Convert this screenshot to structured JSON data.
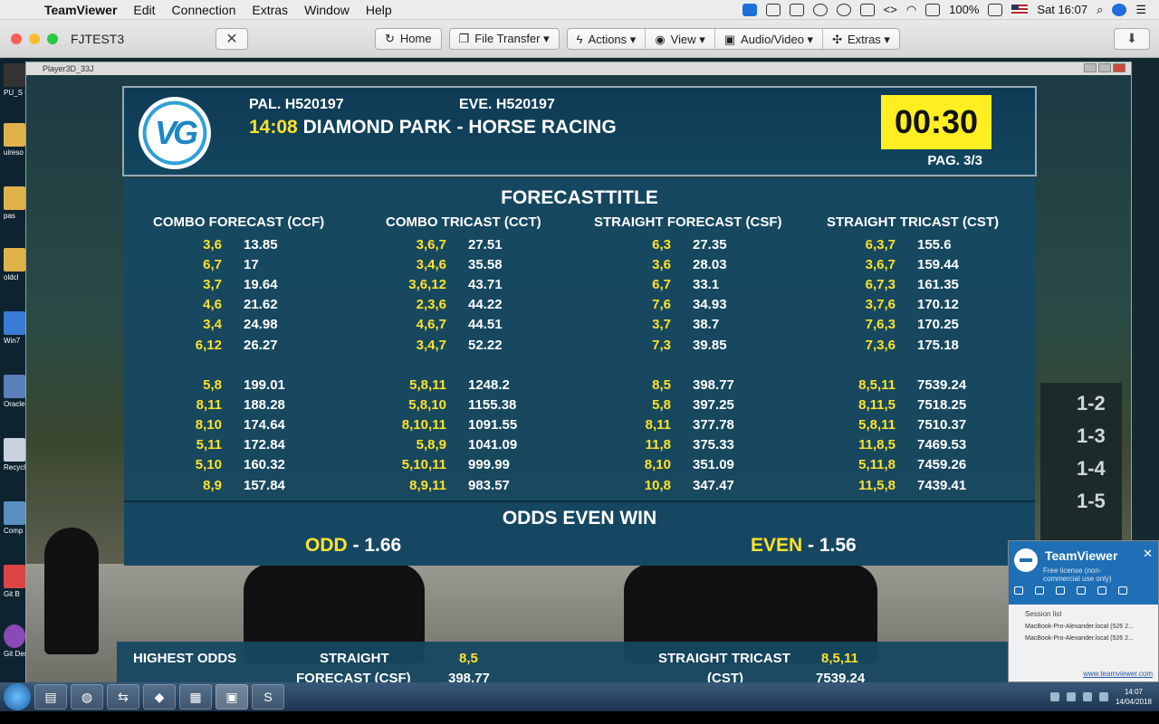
{
  "menubar": {
    "apple": "",
    "app": "TeamViewer",
    "items": [
      "Edit",
      "Connection",
      "Extras",
      "Window",
      "Help"
    ],
    "battery": "100%",
    "clock": "Sat 16:07"
  },
  "toolbar": {
    "session_title": "FJTEST3",
    "close_label": "✕",
    "home": "Home",
    "file_transfer": "File Transfer ▾",
    "actions": "Actions ▾",
    "view": "View ▾",
    "audio_video": "Audio/Video ▾",
    "extras": "Extras ▾",
    "download_icon": "⬇"
  },
  "desktop": {
    "icons": [
      {
        "label": "PU_S Shor"
      },
      {
        "label": "uireso"
      },
      {
        "label": "pas"
      },
      {
        "label": "oldcl"
      },
      {
        "label": "Win7"
      },
      {
        "label": "Oracle Virtu"
      },
      {
        "label": "Recycl"
      },
      {
        "label": "Comp"
      },
      {
        "label": "Git B"
      },
      {
        "label": "Git Desk"
      }
    ]
  },
  "player": {
    "title": "Player3D_33J"
  },
  "broadcast": {
    "logo_text": "VG",
    "pal": "PAL. H520197",
    "eve": "EVE. H520197",
    "race_time": "14:08",
    "race_name": "DIAMOND PARK - HORSE RACING",
    "timer": "00:30",
    "page": "PAG. 3/3",
    "forecast_title": "FORECASTTITLE",
    "columns": [
      {
        "header": "COMBO FORECAST (CCF)",
        "rows": [
          {
            "combo": "3,6",
            "value": "13.85"
          },
          {
            "combo": "6,7",
            "value": "17"
          },
          {
            "combo": "3,7",
            "value": "19.64"
          },
          {
            "combo": "4,6",
            "value": "21.62"
          },
          {
            "combo": "3,4",
            "value": "24.98"
          },
          {
            "combo": "6,12",
            "value": "26.27"
          }
        ],
        "rows2": [
          {
            "combo": "5,8",
            "value": "199.01"
          },
          {
            "combo": "8,11",
            "value": "188.28"
          },
          {
            "combo": "8,10",
            "value": "174.64"
          },
          {
            "combo": "5,11",
            "value": "172.84"
          },
          {
            "combo": "5,10",
            "value": "160.32"
          },
          {
            "combo": "8,9",
            "value": "157.84"
          }
        ]
      },
      {
        "header": "COMBO TRICAST (CCT)",
        "rows": [
          {
            "combo": "3,6,7",
            "value": "27.51"
          },
          {
            "combo": "3,4,6",
            "value": "35.58"
          },
          {
            "combo": "3,6,12",
            "value": "43.71"
          },
          {
            "combo": "2,3,6",
            "value": "44.22"
          },
          {
            "combo": "4,6,7",
            "value": "44.51"
          },
          {
            "combo": "3,4,7",
            "value": "52.22"
          }
        ],
        "rows2": [
          {
            "combo": "5,8,11",
            "value": "1248.2"
          },
          {
            "combo": "5,8,10",
            "value": "1155.38"
          },
          {
            "combo": "8,10,11",
            "value": "1091.55"
          },
          {
            "combo": "5,8,9",
            "value": "1041.09"
          },
          {
            "combo": "5,10,11",
            "value": "999.99"
          },
          {
            "combo": "8,9,11",
            "value": "983.57"
          }
        ]
      },
      {
        "header": "STRAIGHT FORECAST (CSF)",
        "rows": [
          {
            "combo": "6,3",
            "value": "27.35"
          },
          {
            "combo": "3,6",
            "value": "28.03"
          },
          {
            "combo": "6,7",
            "value": "33.1"
          },
          {
            "combo": "7,6",
            "value": "34.93"
          },
          {
            "combo": "3,7",
            "value": "38.7"
          },
          {
            "combo": "7,3",
            "value": "39.85"
          }
        ],
        "rows2": [
          {
            "combo": "8,5",
            "value": "398.77"
          },
          {
            "combo": "5,8",
            "value": "397.25"
          },
          {
            "combo": "8,11",
            "value": "377.78"
          },
          {
            "combo": "11,8",
            "value": "375.33"
          },
          {
            "combo": "8,10",
            "value": "351.09"
          },
          {
            "combo": "10,8",
            "value": "347.47"
          }
        ]
      },
      {
        "header": "STRAIGHT TRICAST (CST)",
        "rows": [
          {
            "combo": "6,3,7",
            "value": "155.6"
          },
          {
            "combo": "3,6,7",
            "value": "159.44"
          },
          {
            "combo": "6,7,3",
            "value": "161.35"
          },
          {
            "combo": "3,7,6",
            "value": "170.12"
          },
          {
            "combo": "7,6,3",
            "value": "170.25"
          },
          {
            "combo": "7,3,6",
            "value": "175.18"
          }
        ],
        "rows2": [
          {
            "combo": "8,5,11",
            "value": "7539.24"
          },
          {
            "combo": "8,11,5",
            "value": "7518.25"
          },
          {
            "combo": "5,8,11",
            "value": "7510.37"
          },
          {
            "combo": "11,8,5",
            "value": "7469.53"
          },
          {
            "combo": "5,11,8",
            "value": "7459.26"
          },
          {
            "combo": "11,5,8",
            "value": "7439.41"
          }
        ]
      }
    ],
    "odds_title": "ODDS EVEN WIN",
    "odd_label": "ODD",
    "odd_value": " - 1.66",
    "even_label": "EVEN",
    "even_value": " - 1.56",
    "footer": {
      "highest": "HIGHEST ODDS",
      "straight": "STRAIGHT",
      "forecast_csf": "FORECAST (CSF)",
      "csf_combo": "8,5",
      "csf_value": "398.77",
      "straight_tricast": "STRAIGHT TRICAST",
      "cst": "(CST)",
      "cst_combo": "8,5,11",
      "cst_value": "7539.24"
    },
    "sign": [
      "1-2",
      "1-3",
      "1-4",
      "1-5"
    ]
  },
  "tv_popup": {
    "name": "TeamViewer",
    "license": "Free license (non-commercial use only)",
    "close": "✕",
    "session_list": "Session list",
    "sessions": [
      "MacBook-Pro-Alexander.local (526 2...",
      "MacBook-Pro-Alexander.local (526 2..."
    ],
    "link": "www.teamviewer.com"
  },
  "taskbar": {
    "time": "14:07",
    "date": "14/04/2018"
  }
}
